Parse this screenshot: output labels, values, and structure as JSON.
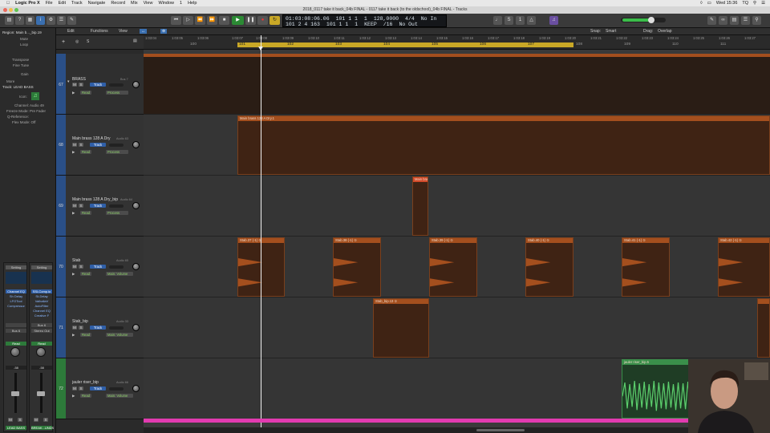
{
  "menubar": {
    "app": "Logic Pro X",
    "items": [
      "File",
      "Edit",
      "Track",
      "Navigate",
      "Record",
      "Mix",
      "View",
      "Window",
      "1",
      "Help"
    ],
    "status": "Wed 15:36",
    "user": "TQ"
  },
  "window": {
    "title": "2018_0117 take it back_04b FINAL - 0117 take it back (to the oldschool)_04b FINAL - Tracks"
  },
  "lcd": {
    "smpte": "01:03:08:06.06",
    "bars": "101 1 1",
    "beat": "1",
    "tempo": "128,0000",
    "sig": "4/4",
    "keep_bars": "101 2 4 163",
    "keep_b": "101 1 1",
    "keep_n": "1",
    "keep": "KEEP",
    "div": "/16",
    "in": "No In",
    "out": "No Out"
  },
  "toolbar": {
    "region": "Region: Main b..._bip.19",
    "edit": "Edit",
    "functions": "Functions",
    "view": "View",
    "snap_label": "Snap:",
    "snap": "Smart",
    "drag_label": "Drag:",
    "drag": "Overlap"
  },
  "inspector": {
    "mute": "Mute",
    "loop": "Loop",
    "transpose": "Transpose",
    "fine_tune": "Fine Tune",
    "gain": "Gain",
    "more": "More",
    "track_label": "Track:",
    "track_name": "LEAD BASS",
    "icon": "Icon:",
    "channel": "Channel:",
    "channel_val": "Audio 49",
    "freeze": "Freeze Mode:",
    "freeze_val": "Pre Fader",
    "q": "Q-Reference:",
    "flex": "Flex Mode:",
    "flex_val": "Off"
  },
  "strips": [
    {
      "setting": "Setting",
      "eq": "",
      "plugins": [
        "Channel EQ",
        "Sh Delay",
        "LFOTool",
        "Compressor"
      ],
      "send": "",
      "bus": "Bus 6",
      "auto": "Read",
      "vol": "-58",
      "name": "LEAD BASS"
    },
    {
      "setting": "Setting",
      "eq": "",
      "plugins": [
        "SSLComp.io",
        "St-Delay",
        "ValhallaV",
        "AutoFilter",
        "Channel EQ",
        "Creative F"
      ],
      "send": "Bus 6",
      "bus": "Stereo Out",
      "auto": "Read",
      "vol": "-58",
      "name": "BREAK...UNDS"
    }
  ],
  "ruler": {
    "ticks": [
      "1:03:04",
      "1:03:05",
      "1:03:06",
      "1:03:07",
      "1:03:08",
      "1:03:09",
      "1:03:10",
      "1:03:11",
      "1:03:12",
      "1:03:13",
      "1:03:14",
      "1:03:15",
      "1:03:16",
      "1:03:17",
      "1:03:18",
      "1:03:19",
      "1:03:20",
      "1:03:21",
      "1:03:22",
      "1:03:23",
      "1:03:24",
      "1:03:25",
      "1:03:26",
      "1:03:27"
    ],
    "bars": [
      "100",
      "101",
      "102",
      "103",
      "104",
      "105",
      "106",
      "107",
      "108",
      "109",
      "110",
      "111"
    ]
  },
  "tracks": [
    {
      "num": "67",
      "name": "BRASS",
      "output": "Bus 7",
      "auto": "Read",
      "plugin": "Process",
      "is_folder": true
    },
    {
      "num": "68",
      "name": "Main brass 128 A Dry",
      "output": "Audio 63",
      "auto": "Read",
      "plugin": "Process"
    },
    {
      "num": "69",
      "name": "Main brass 128 A Dry_bip",
      "output": "Audio 64",
      "auto": "Read",
      "plugin": "Process"
    },
    {
      "num": "70",
      "name": "Stab",
      "output": "Audio 65",
      "auto": "Read",
      "plugin": "Main: Volume"
    },
    {
      "num": "71",
      "name": "Stab_bip",
      "output": "Audio 33",
      "auto": "Read",
      "plugin": "Main: Volume"
    },
    {
      "num": "72",
      "name": "jauler riser_bip",
      "output": "Audio 66",
      "auto": "Read",
      "plugin": "Main: Volume"
    }
  ],
  "regions": {
    "main_brass": "Main brass 128 A Dry.1",
    "main_bip": "Main brass",
    "stabs": [
      "Stab.37 (-1) ①",
      "Stab.38 (-1) ①",
      "Stab.39 (-1) ①",
      "Stab.40 (-1) ①",
      "Stab.41 (-1) ①",
      "Stab.42 (-1) ①"
    ],
    "stab_bip": "Stab_bip.13 ①",
    "riser": "jauler riser_bip.5"
  },
  "colors": {
    "region_orange": "#a44f1e",
    "region_dark": "#3f2314",
    "track_blue": "#2f5fa8",
    "riser_green": "#3a8f4a",
    "cycle": "#c9a826",
    "pink": "#e23bb0"
  }
}
